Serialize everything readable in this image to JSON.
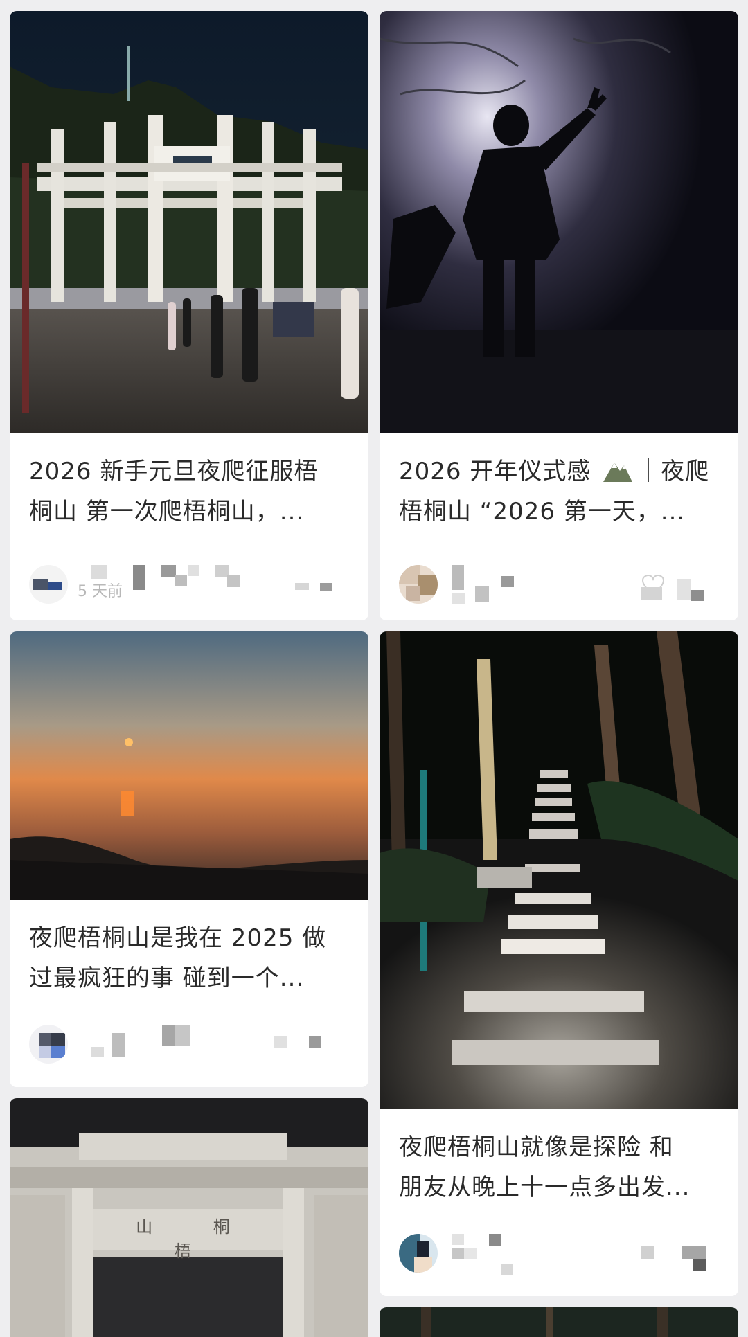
{
  "feed": {
    "posts": [
      {
        "title_line1": "2026 新手元旦夜爬征服梧",
        "title_line2": "桐山 第一次爬梧桐山，...",
        "time": "5 天前",
        "image": "night-archway-crowd"
      },
      {
        "title_line1": "2026 开年仪式感",
        "title_line1b": "｜夜爬",
        "title_line2": "梧桐山 “2026 第一天，...",
        "image": "silhouette-victory-pose",
        "like_count": "10"
      },
      {
        "title_line1": "夜爬梧桐山是我在 2025 做",
        "title_line2": "过最疯狂的事 碰到一个...",
        "image": "sunrise-over-sea"
      },
      {
        "title_line1": "夜爬梧桐山就像是探险 和",
        "title_line2": "朋友从晚上十一点多出发...",
        "image": "lit-stone-stairs-forest"
      },
      {
        "image": "stone-archway-closeup",
        "archway_text": "山 桐 梧"
      },
      {
        "image": "forest-top-partial"
      }
    ],
    "icons": [
      "mountain-emoji-icon",
      "heart-icon"
    ],
    "colors": {
      "background": "#eeeef0",
      "card": "#ffffff",
      "text": "#2a2a2a",
      "muted": "#b8b8b8"
    }
  }
}
